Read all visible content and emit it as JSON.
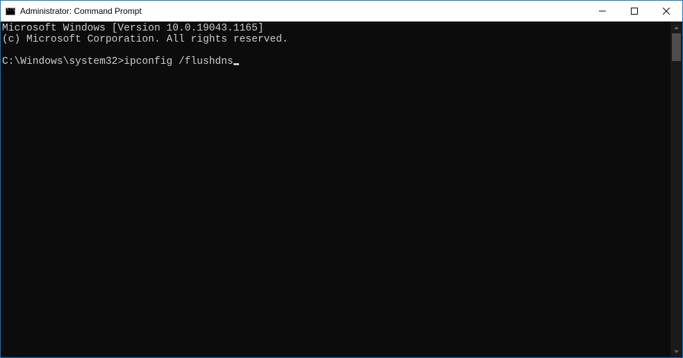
{
  "window": {
    "title": "Administrator: Command Prompt"
  },
  "terminal": {
    "line1": "Microsoft Windows [Version 10.0.19043.1165]",
    "line2": "(c) Microsoft Corporation. All rights reserved.",
    "blank": "",
    "prompt": "C:\\Windows\\system32>",
    "command": "ipconfig /flushdns"
  }
}
